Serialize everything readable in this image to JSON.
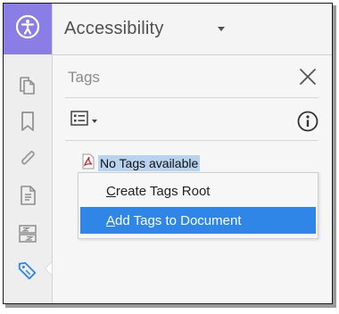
{
  "header": {
    "title": "Accessibility"
  },
  "panel": {
    "title": "Tags"
  },
  "tree": {
    "status_text": "No Tags available"
  },
  "context_menu": {
    "items": [
      {
        "label_pre": "",
        "label_u": "C",
        "label_post": "reate Tags Root",
        "active": false
      },
      {
        "label_pre": "",
        "label_u": "A",
        "label_post": "dd Tags to Document",
        "active": true
      }
    ]
  },
  "rail": {
    "tools": [
      "accessibility-icon",
      "pages-icon",
      "bookmark-icon",
      "attachment-icon",
      "content-icon",
      "order-icon",
      "tags-icon"
    ]
  },
  "colors": {
    "accent": "#8a7ee6",
    "menu_highlight": "#2f86e6",
    "tag_highlight": "#b7d3ee"
  }
}
